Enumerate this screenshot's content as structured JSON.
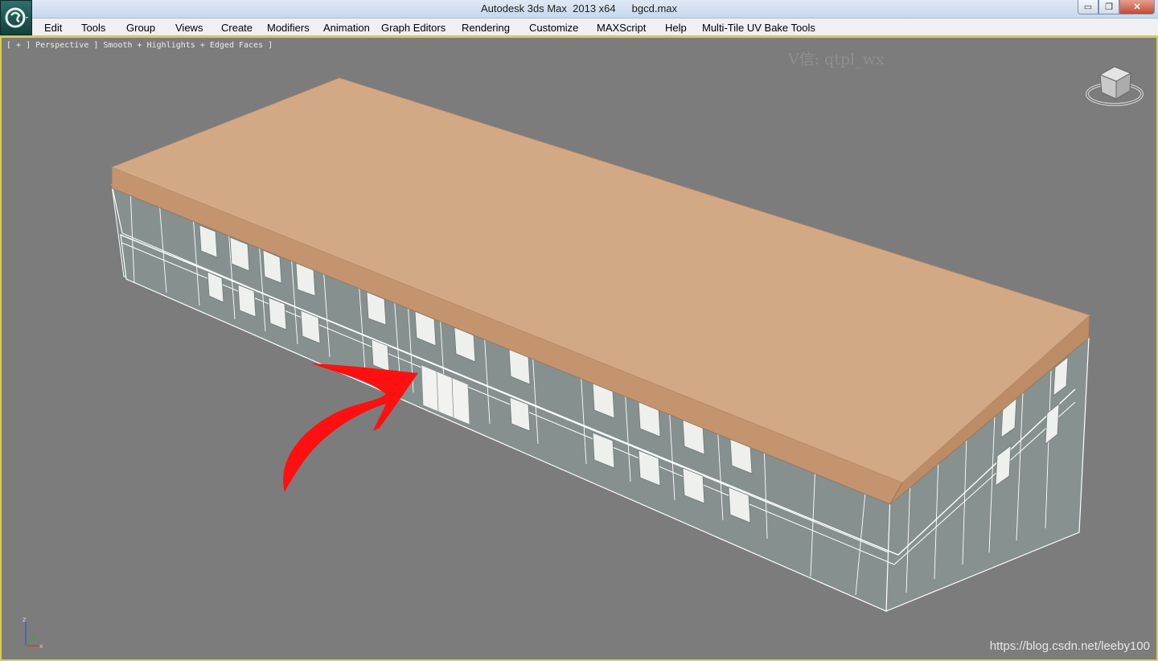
{
  "window": {
    "app_title": "Autodesk 3ds Max  2013 x64",
    "file_name": "bgcd.max",
    "buttons": {
      "minimize": "▭",
      "restore": "❐",
      "close": "✕"
    }
  },
  "menu": {
    "items": [
      "Edit",
      "Tools",
      "Group",
      "Views",
      "Create",
      "Modifiers",
      "Animation",
      "Graph Editors",
      "Rendering",
      "Customize",
      "MAXScript",
      "Help",
      "Multi-Tile UV Bake Tools"
    ]
  },
  "viewport": {
    "label": "[ + ] Perspective ] Smooth + Highlights + Edged Faces ]",
    "watermark": "V信: qtpl_wx",
    "source_watermark": "https://blog.csdn.net/leeby100",
    "colors": {
      "background": "#7c7c7c",
      "active_border": "#d9cc4a",
      "roof_top": "#d3a985",
      "roof_side": "#c3946e",
      "wall": "#85908f",
      "edges": "#ffffff",
      "arrow": "#ff1010"
    },
    "viewcube_icon": "viewcube-icon",
    "axis_icon": "axis-tripod-icon",
    "axis_labels": {
      "x": "x",
      "z": "z"
    }
  }
}
